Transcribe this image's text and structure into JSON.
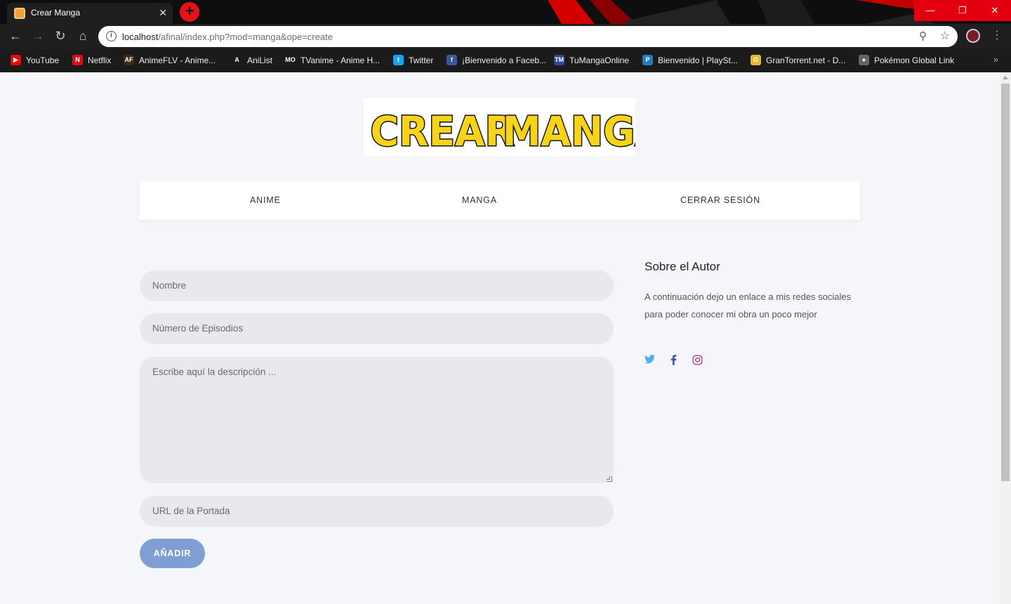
{
  "browser": {
    "tab_title": "Crear Manga",
    "tab_close": "✕",
    "new_tab": "+",
    "window_buttons": [
      "—",
      "❐",
      "✕"
    ],
    "url_host": "localhost",
    "url_rest": "/afinal/index.php?mod=manga&ope=create",
    "nav": {
      "back": "←",
      "forward": "→",
      "reload": "↻",
      "home": "⌂"
    },
    "bookmarks": [
      {
        "label": "YouTube",
        "icon": "youtube-icon",
        "color": "#ff0000",
        "glyph": "▶"
      },
      {
        "label": "Netflix",
        "icon": "netflix-icon",
        "color": "#e50914",
        "glyph": "N"
      },
      {
        "label": "AnimeFLV - Anime...",
        "icon": "animeflv-icon",
        "color": "#3a2a1a",
        "glyph": "AF"
      },
      {
        "label": "AniList",
        "icon": "anilist-icon",
        "color": "#1b1b1b",
        "glyph": "A"
      },
      {
        "label": "TVanime - Anime H...",
        "icon": "tvanime-icon",
        "color": "#1b1b1b",
        "glyph": "MO"
      },
      {
        "label": "Twitter",
        "icon": "twitter-icon",
        "color": "#1da1f2",
        "glyph": "t"
      },
      {
        "label": "¡Bienvenido a Faceb...",
        "icon": "facebook-icon",
        "color": "#3b5998",
        "glyph": "f"
      },
      {
        "label": "TuMangaOnline",
        "icon": "tumangaonline-icon",
        "color": "#2b4a9c",
        "glyph": "TM"
      },
      {
        "label": "Bienvenido | PlaySt...",
        "icon": "playstation-icon",
        "color": "#1f7ec2",
        "glyph": "P"
      },
      {
        "label": "GranTorrent.net - D...",
        "icon": "grantorrent-icon",
        "color": "#e8b923",
        "glyph": "G"
      },
      {
        "label": "Pokémon Global Link",
        "icon": "pokemon-icon",
        "color": "#666666",
        "glyph": "●"
      }
    ],
    "bookmarks_more": "»"
  },
  "page": {
    "logo_text_left": "CREAR",
    "logo_text_right": "MANGA",
    "nav": [
      "ANIME",
      "MANGA",
      "CERRAR SESIÓN"
    ],
    "form": {
      "name_placeholder": "Nombre",
      "episodes_placeholder": "Número de Episodios",
      "description_placeholder": "Escribe aquí la descripción ...",
      "cover_placeholder": "URL de la Portada",
      "submit_label": "AÑADIR"
    },
    "aside": {
      "title": "Sobre el Autor",
      "text": "A continuación dejo un enlace a mis redes sociales para poder conocer mi obra un poco mejor",
      "social": [
        {
          "icon": "twitter-icon",
          "glyph": "🐦",
          "color": "#55acee"
        },
        {
          "icon": "facebook-icon",
          "glyph": "f",
          "color": "#3b5998"
        },
        {
          "icon": "instagram-icon",
          "glyph": "◎",
          "color": "#c13584"
        }
      ]
    },
    "colors": {
      "button": "#7f9ed4",
      "field": "#e8e9ec",
      "background": "#f5f6f9",
      "logo_yellow": "#f7d417"
    }
  }
}
